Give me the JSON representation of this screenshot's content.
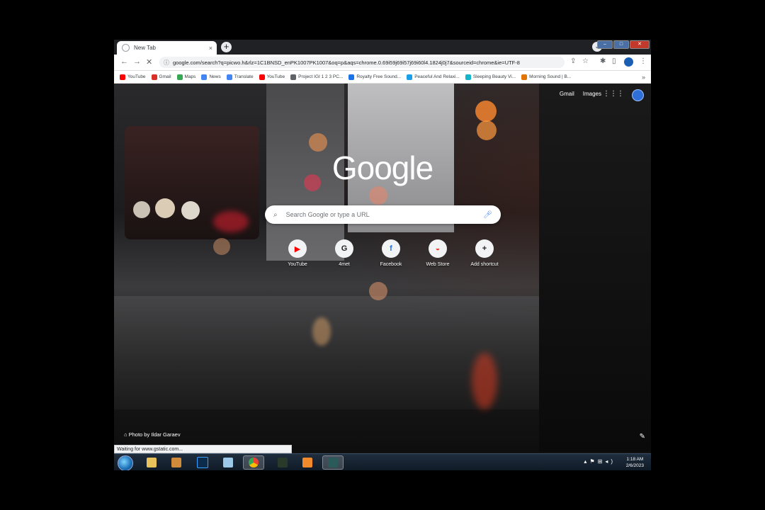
{
  "tab": {
    "title": "New Tab",
    "close": "×"
  },
  "url": "google.com/search?q=picwo.h&rlz=1C1BNSD_enPK1007PK1007&oq=p&aqs=chrome.0.69i59j69i57j69i60l4.1824j0j7&sourceid=chrome&ie=UTF-8",
  "bookmarks": [
    {
      "label": "YouTube",
      "color": "#ff0000"
    },
    {
      "label": "Gmail",
      "color": "#d93025"
    },
    {
      "label": "Maps",
      "color": "#34a853"
    },
    {
      "label": "News",
      "color": "#4285f4"
    },
    {
      "label": "Translate",
      "color": "#4285f4"
    },
    {
      "label": "YouTube",
      "color": "#ff0000"
    },
    {
      "label": "Project IGI 1 2 3 PC...",
      "color": "#5f6368"
    },
    {
      "label": "Royalty Free Sound...",
      "color": "#1a73e8"
    },
    {
      "label": "Peaceful And Relaxi...",
      "color": "#1aa0e8"
    },
    {
      "label": "Sleeping Beauty Vi...",
      "color": "#12b5cb"
    },
    {
      "label": "Morning Sound | B...",
      "color": "#e37400"
    }
  ],
  "more_bookmarks": "»",
  "header": {
    "gmail": "Gmail",
    "images": "Images"
  },
  "logo": "Google",
  "search": {
    "placeholder": "Search Google or type a URL"
  },
  "shortcuts": [
    {
      "label": "YouTube",
      "glyph": "▶",
      "color": "#ff0000"
    },
    {
      "label": "4met",
      "glyph": "G",
      "color": "#202124"
    },
    {
      "label": "Facebook",
      "glyph": "f",
      "color": "#1877f2"
    },
    {
      "label": "Web Store",
      "glyph": "◒",
      "color": "#ea4335"
    },
    {
      "label": "Add shortcut",
      "glyph": "+",
      "color": "#202124"
    }
  ],
  "photo_credit": "Photo by Ildar Garaev",
  "status": "Waiting for www.gstatic.com...",
  "clock": {
    "time": "1:18 AM",
    "date": "2/6/2023"
  }
}
